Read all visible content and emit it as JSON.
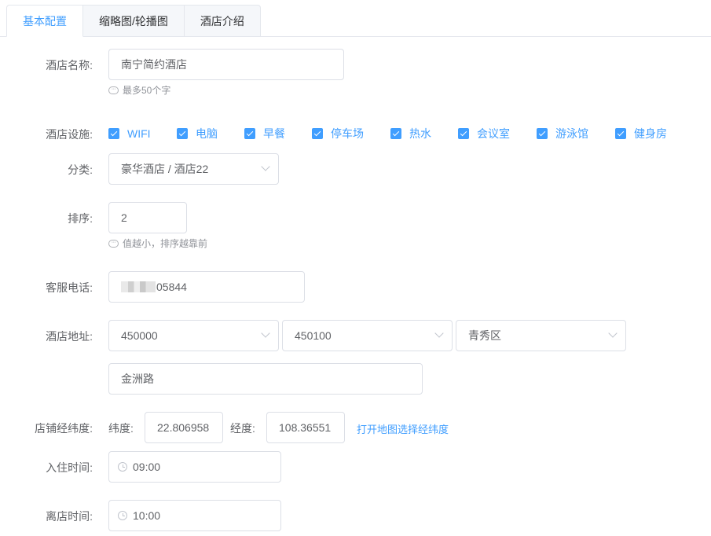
{
  "tabs": [
    {
      "label": "基本配置",
      "active": true
    },
    {
      "label": "缩略图/轮播图",
      "active": false
    },
    {
      "label": "酒店介绍",
      "active": false
    }
  ],
  "form": {
    "name": {
      "label": "酒店名称:",
      "value": "南宁简约酒店",
      "hint": "最多50个字"
    },
    "facilities": {
      "label": "酒店设施:",
      "items": [
        "WIFI",
        "电脑",
        "早餐",
        "停车场",
        "热水",
        "会议室",
        "游泳馆",
        "健身房"
      ]
    },
    "category": {
      "label": "分类:",
      "value": "豪华酒店 / 酒店22"
    },
    "sort": {
      "label": "排序:",
      "value": "2",
      "hint": "值越小，排序越靠前"
    },
    "phone": {
      "label": "客服电话:",
      "value_visible": "05844"
    },
    "address": {
      "label": "酒店地址:",
      "province": "450000",
      "city": "450100",
      "district": "青秀区",
      "street": "金洲路"
    },
    "coords": {
      "label": "店铺经纬度:",
      "lat_label": "纬度:",
      "lat_value": "22.806958",
      "lng_label": "经度:",
      "lng_value": "108.36551",
      "map_link": "打开地图选择经纬度"
    },
    "checkin": {
      "label": "入住时间:",
      "value": "09:00"
    },
    "checkout": {
      "label": "离店时间:",
      "value": "10:00"
    }
  },
  "colors": {
    "accent": "#409eff",
    "text": "#606266",
    "border": "#dcdfe6",
    "hint": "#909399"
  }
}
